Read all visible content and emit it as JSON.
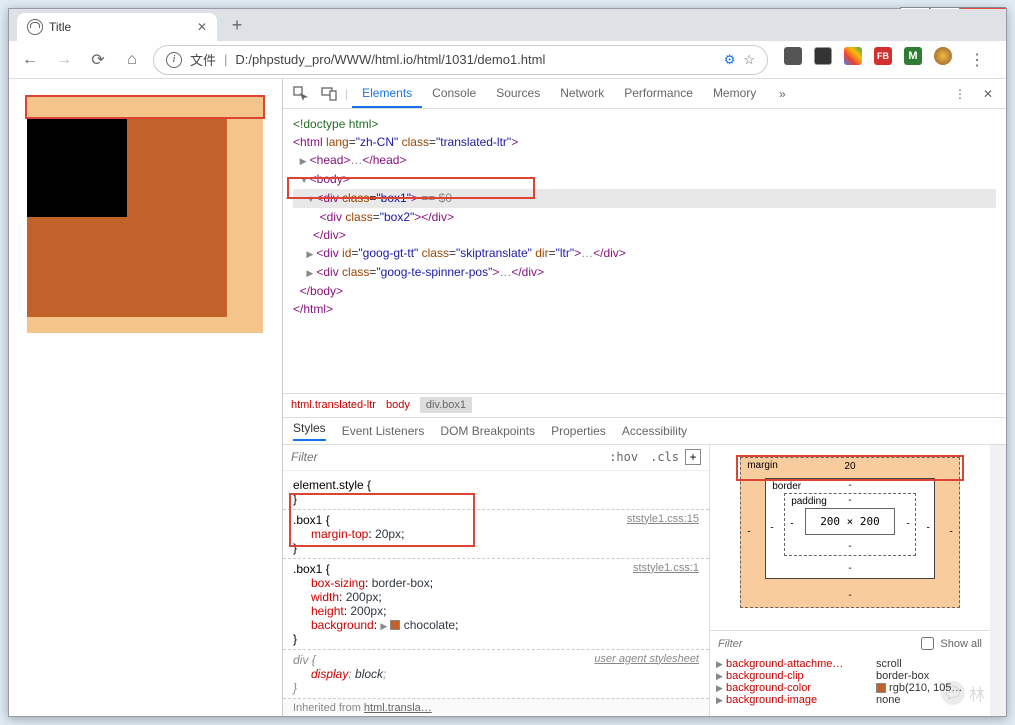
{
  "browser": {
    "tab_title": "Title",
    "address_prefix": "文件",
    "url": "D:/phpstudy_pro/WWW/html.io/html/1031/demo1.html"
  },
  "page_render": {
    "box1_bg": "chocolate",
    "box1_w": 200,
    "box1_h": 200,
    "box2_w": 100,
    "box2_h": 100,
    "margin_top": 20
  },
  "devtools": {
    "tabs": [
      "Elements",
      "Console",
      "Sources",
      "Network",
      "Performance",
      "Memory"
    ],
    "active_tab": "Elements",
    "dom": {
      "doctype": "<!doctype html>",
      "html_open": "<html lang=\"zh-CN\" class=\"translated-ltr\">",
      "head": "<head>…</head>",
      "body_open": "<body>",
      "box1": "<div class=\"box1\">",
      "selected_suffix": " == $0",
      "box2": "<div class=\"box2\"></div>",
      "box1_close": "</div>",
      "goog_tt": "<div id=\"goog-gt-tt\" class=\"skiptranslate\" dir=\"ltr\">…</div>",
      "goog_spinner": "<div class=\"goog-te-spinner-pos\">…</div>",
      "body_close": "</body>",
      "html_close": "</html>"
    },
    "breadcrumb": [
      "html.translated-ltr",
      "body",
      "div.box1"
    ],
    "styles_tabs": [
      "Styles",
      "Event Listeners",
      "DOM Breakpoints",
      "Properties",
      "Accessibility"
    ],
    "active_styles_tab": "Styles",
    "filter_placeholder": "Filter",
    "hov_label": ":hov",
    "cls_label": ".cls",
    "rules": [
      {
        "selector": "element.style",
        "src": "",
        "props": []
      },
      {
        "selector": ".box1",
        "src": "ststyle1.css:15",
        "props": [
          {
            "n": "margin-top",
            "v": "20px"
          }
        ]
      },
      {
        "selector": ".box1",
        "src": "ststyle1.css:1",
        "props": [
          {
            "n": "box-sizing",
            "v": "border-box"
          },
          {
            "n": "width",
            "v": "200px"
          },
          {
            "n": "height",
            "v": "200px"
          },
          {
            "n": "background",
            "v": "chocolate",
            "swatch": "#c0622a"
          }
        ]
      },
      {
        "selector": "div",
        "src": "user agent stylesheet",
        "italic": true,
        "props": [
          {
            "n": "display",
            "v": "block"
          }
        ]
      }
    ],
    "inherited_label": "Inherited from",
    "inherited_from": "html.transla…",
    "box_model": {
      "margin": {
        "label": "margin",
        "top": "20",
        "right": "-",
        "bottom": "-",
        "left": "-"
      },
      "border": {
        "label": "border",
        "val": "-"
      },
      "padding": {
        "label": "padding",
        "val": "-"
      },
      "content": "200 × 200"
    },
    "computed_filter": "Filter",
    "show_all": "Show all",
    "computed": [
      {
        "n": "background-attachme…",
        "v": "scroll"
      },
      {
        "n": "background-clip",
        "v": "border-box"
      },
      {
        "n": "background-color",
        "v": "rgb(210, 105…",
        "swatch": "#c0622a"
      },
      {
        "n": "background-image",
        "v": "none"
      }
    ]
  },
  "watermark": "林"
}
